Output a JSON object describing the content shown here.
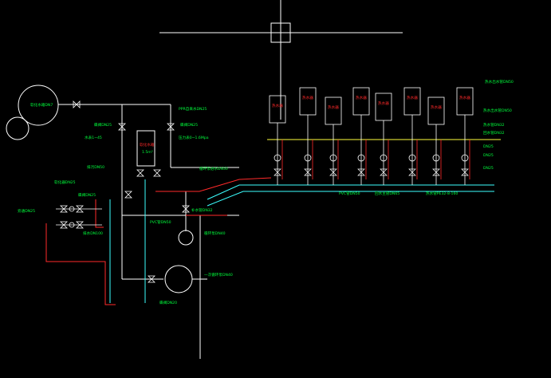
{
  "colors": {
    "background": "#000000",
    "white": "#ffffff",
    "green": "#00ff3c",
    "red": "#ff2a2a",
    "yellow": "#ffff3c",
    "cyan": "#3cffff",
    "magenta": "#ff3cff"
  },
  "labels": {
    "tank_left": "软化水箱DN7",
    "ppr_pipe": "PPR自来水DN25",
    "valve_top1": "蝶阀DN25",
    "meter1": "水表1~45",
    "gauge1": "压力表0~1.6Mpa",
    "tank_center": "软化水箱",
    "tank_volume": "1.5m³",
    "drain_left": "排污DN50",
    "softener": "软化器DN25",
    "soft_valve": "蝶阀DN25",
    "loop_label": "循环泵进水DN50",
    "bypass": "旁通DN25",
    "bottom_pipe": "排水DN100",
    "mid_pipe": "补水管DN32",
    "pvc_label1": "PVC管DN50",
    "pump_small": "循环泵DN40",
    "pvc_vertical": "PVC排污管DN100",
    "pump_big": "一次循环泵DN40",
    "valve_bottom": "蝶阀DN20",
    "hw_main": "热水出水管DN50",
    "hw_branch": "热水管DN32",
    "return_pipe": "回水管DN32",
    "g1": "DN25",
    "g2": "DN25",
    "g3": "DN25",
    "pvc_bottom": "PVC管DN50",
    "return_main": "回水主管DN65",
    "boiler_main": "热水管PE32-8-160",
    "top_right": "热水出水管DN50",
    "heater_unit": "热水器",
    "heater_spec": "12KW/220V"
  },
  "heaters": [
    {
      "label": "热水器"
    },
    {
      "label": "热水器"
    },
    {
      "label": "热水器"
    },
    {
      "label": "热水器"
    },
    {
      "label": "热水器"
    },
    {
      "label": "热水器"
    },
    {
      "label": "热水器"
    },
    {
      "label": "热水器"
    }
  ]
}
